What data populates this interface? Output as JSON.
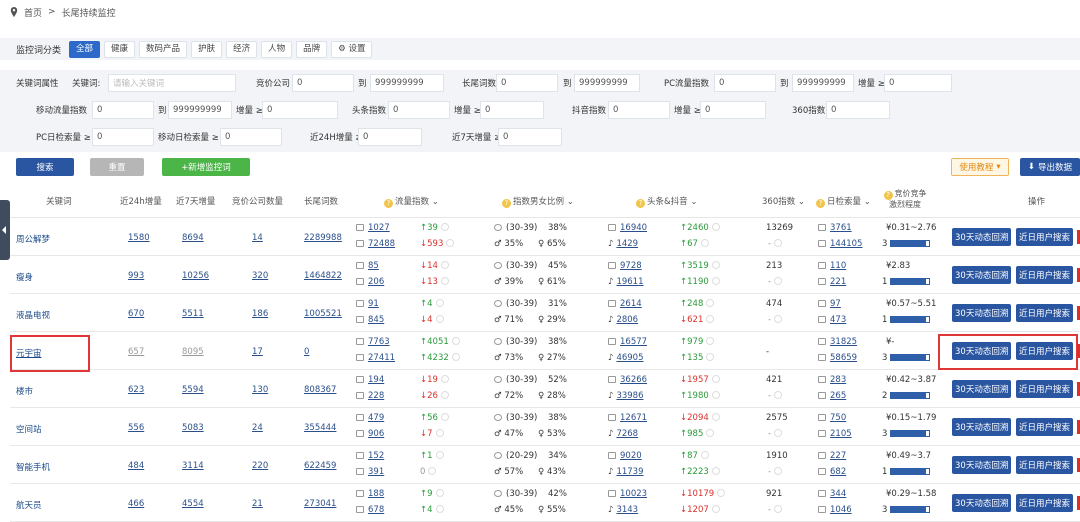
{
  "breadcrumb": {
    "home": "首页",
    "sep": ">",
    "current": "长尾持续监控"
  },
  "categories": {
    "label": "监控词分类",
    "items": [
      "全部",
      "健康",
      "数码产品",
      "护肤",
      "经济",
      "人物",
      "品牌"
    ],
    "settings": "设置"
  },
  "filters": {
    "row1": {
      "section": "关键词属性",
      "kw_label": "关键词:",
      "kw_placeholder": "请输入关键词",
      "bid_label": "竞价公司",
      "bid_min": "0",
      "to": "到",
      "bid_max": "999999999",
      "tail_label": "长尾词数",
      "tail_min": "0",
      "tail_max": "999999999",
      "pc_label": "PC流量指数",
      "pc_min": "0",
      "pc_max": "999999999",
      "growth_label": "增量 ≥",
      "growth_val": "0"
    },
    "row2": {
      "mobile_label": "移动流量指数",
      "mobile_min": "0",
      "to": "到",
      "mobile_max": "999999999",
      "growth_label": "增量 ≥",
      "growth_val": "0",
      "toutiao_label": "头条指数",
      "toutiao_val": "0",
      "toutiao_growth_label": "增量 ≥",
      "toutiao_growth_val": "0",
      "douyin_label": "抖音指数",
      "douyin_val": "0",
      "douyin_growth_label": "增量 ≥",
      "douyin_growth_val": "0",
      "s360_label": "360指数",
      "s360_val": "0"
    },
    "row3": {
      "pc_search_label": "PC日检索量 ≥",
      "pc_search_val": "0",
      "mob_search_label": "移动日检索量 ≥",
      "mob_search_val": "0",
      "h24_label": "近24H增量 ≥",
      "h24_val": "0",
      "d7_label": "近7天增量 ≥",
      "d7_val": "0"
    }
  },
  "buttons": {
    "search": "搜索",
    "reset": "重置",
    "add": "+新增监控词",
    "tutorial": "使用教程",
    "export": "导出数据"
  },
  "headers": [
    "关键词",
    "近24h增量",
    "近7天增量",
    "竞价公司数量",
    "长尾词数",
    "流量指数",
    "指数男女比例",
    "头条&抖音",
    "360指数",
    "日检索量",
    "竞价竞争激烈程度",
    "操作"
  ],
  "actions": {
    "trace": "30天动态回溯",
    "users": "近日用户搜索"
  },
  "colors": {
    "accent": "#2a55a0",
    "up": "#2a9a3a",
    "down": "#d9302a",
    "highlight": "#e0363a"
  },
  "rows": [
    {
      "kw": "周公解梦",
      "h24": "1580",
      "d7": "8694",
      "bid": "14",
      "tail": "2289988",
      "pc": "1027",
      "pc_ch": "↑39",
      "pc_dir": "up",
      "mob": "72488",
      "mob_ch": "↓593",
      "mob_dir": "dn",
      "age": "(30-39)",
      "age_pct": "38%",
      "male": "35%",
      "female": "65%",
      "tt": "16940",
      "tt_ch": "↑2460",
      "tt_dir": "up",
      "dy": "1429",
      "dy_ch": "↑67",
      "dy_dir": "up",
      "s360": "13269",
      "s360b": "-",
      "pcs": "3761",
      "mobs": "144105",
      "price": "¥0.31~2.76",
      "lvl": "3",
      "fill": 0.9
    },
    {
      "kw": "瘦身",
      "h24": "993",
      "d7": "10256",
      "bid": "320",
      "tail": "1464822",
      "pc": "85",
      "pc_ch": "↓14",
      "pc_dir": "dn",
      "mob": "206",
      "mob_ch": "↓13",
      "mob_dir": "dn",
      "age": "(30-39)",
      "age_pct": "45%",
      "male": "39%",
      "female": "61%",
      "tt": "9728",
      "tt_ch": "↑3519",
      "tt_dir": "up",
      "dy": "19611",
      "dy_ch": "↑1190",
      "dy_dir": "up",
      "s360": "213",
      "s360b": "-",
      "pcs": "110",
      "mobs": "221",
      "price": "¥2.83",
      "lvl": "1",
      "fill": 0.9
    },
    {
      "kw": "液晶电视",
      "h24": "670",
      "d7": "5511",
      "bid": "186",
      "tail": "1005521",
      "pc": "91",
      "pc_ch": "↑4",
      "pc_dir": "up",
      "mob": "845",
      "mob_ch": "↓4",
      "mob_dir": "dn",
      "age": "(30-39)",
      "age_pct": "31%",
      "male": "71%",
      "female": "29%",
      "tt": "2614",
      "tt_ch": "↑248",
      "tt_dir": "up",
      "dy": "2806",
      "dy_ch": "↓621",
      "dy_dir": "dn",
      "s360": "474",
      "s360b": "-",
      "pcs": "97",
      "mobs": "473",
      "price": "¥0.57~5.51",
      "lvl": "1",
      "fill": 0.9
    },
    {
      "kw": "元宇宙",
      "h24": "657",
      "d7": "8095",
      "bid": "17",
      "tail": "0",
      "pc": "7763",
      "pc_ch": "↑4051",
      "pc_dir": "up",
      "mob": "27411",
      "mob_ch": "↑4232",
      "mob_dir": "up",
      "age": "(30-39)",
      "age_pct": "38%",
      "male": "73%",
      "female": "27%",
      "tt": "16577",
      "tt_ch": "↑979",
      "tt_dir": "up",
      "dy": "46905",
      "dy_ch": "↑135",
      "dy_dir": "up",
      "s360": "-",
      "s360b": "",
      "pcs": "31825",
      "mobs": "58659",
      "price": "¥-",
      "lvl": "3",
      "fill": 0.9
    },
    {
      "kw": "楼市",
      "h24": "623",
      "d7": "5594",
      "bid": "130",
      "tail": "808367",
      "pc": "194",
      "pc_ch": "↓19",
      "pc_dir": "dn",
      "mob": "228",
      "mob_ch": "↓26",
      "mob_dir": "dn",
      "age": "(30-39)",
      "age_pct": "52%",
      "male": "72%",
      "female": "28%",
      "tt": "36266",
      "tt_ch": "↓1957",
      "tt_dir": "dn",
      "dy": "33986",
      "dy_ch": "↑1980",
      "dy_dir": "up",
      "s360": "421",
      "s360b": "-",
      "pcs": "283",
      "mobs": "265",
      "price": "¥0.42~3.87",
      "lvl": "2",
      "fill": 0.9
    },
    {
      "kw": "空间站",
      "h24": "556",
      "d7": "5083",
      "bid": "24",
      "tail": "355444",
      "pc": "479",
      "pc_ch": "↑56",
      "pc_dir": "up",
      "mob": "906",
      "mob_ch": "↓7",
      "mob_dir": "dn",
      "age": "(30-39)",
      "age_pct": "38%",
      "male": "47%",
      "female": "53%",
      "tt": "12671",
      "tt_ch": "↓2094",
      "tt_dir": "dn",
      "dy": "7268",
      "dy_ch": "↑985",
      "dy_dir": "up",
      "s360": "2575",
      "s360b": "-",
      "pcs": "750",
      "mobs": "2105",
      "price": "¥0.15~1.79",
      "lvl": "3",
      "fill": 0.9
    },
    {
      "kw": "智能手机",
      "h24": "484",
      "d7": "3114",
      "bid": "220",
      "tail": "622459",
      "pc": "152",
      "pc_ch": "↑1",
      "pc_dir": "up",
      "mob": "391",
      "mob_ch": "0",
      "mob_dir": "none",
      "age": "(20-29)",
      "age_pct": "34%",
      "male": "57%",
      "female": "43%",
      "tt": "9020",
      "tt_ch": "↑87",
      "tt_dir": "up",
      "dy": "11739",
      "dy_ch": "↑2223",
      "dy_dir": "up",
      "s360": "1910",
      "s360b": "-",
      "pcs": "227",
      "mobs": "682",
      "price": "¥0.49~3.7",
      "lvl": "1",
      "fill": 0.9
    },
    {
      "kw": "航天员",
      "h24": "466",
      "d7": "4554",
      "bid": "21",
      "tail": "273041",
      "pc": "188",
      "pc_ch": "↑9",
      "pc_dir": "up",
      "mob": "678",
      "mob_ch": "↑4",
      "mob_dir": "up",
      "age": "(30-39)",
      "age_pct": "42%",
      "male": "45%",
      "female": "55%",
      "tt": "10023",
      "tt_ch": "↓10179",
      "tt_dir": "dn",
      "dy": "3143",
      "dy_ch": "↓1207",
      "dy_dir": "dn",
      "s360": "921",
      "s360b": "-",
      "pcs": "344",
      "mobs": "1046",
      "price": "¥0.29~1.58",
      "lvl": "3",
      "fill": 0.9
    }
  ]
}
